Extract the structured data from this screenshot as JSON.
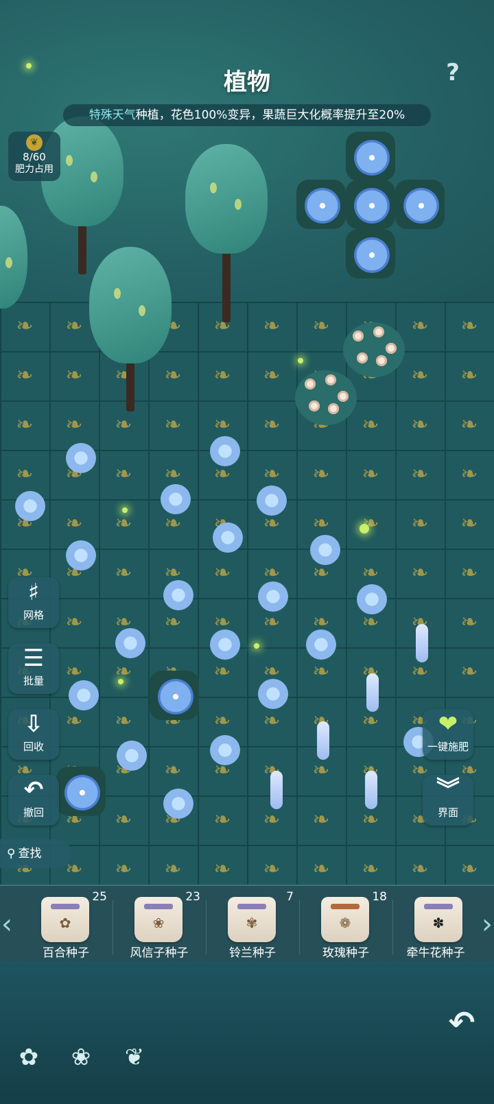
{
  "header": {
    "title": "植物",
    "help_icon": "?",
    "weather_banner": {
      "highlight": "特殊天气",
      "text": "种植，花色100%变异，果蔬巨大化概率提升至20%"
    }
  },
  "fertilizer": {
    "count": "8/60",
    "label": "肥力占用"
  },
  "side_tools": {
    "grid": "网格",
    "batch": "批量",
    "recycle": "回收",
    "undo": "撤回",
    "search": "查找"
  },
  "right_tools": {
    "fertilize_all": "一键施肥",
    "interface": "界面"
  },
  "seeds": [
    {
      "name": "百合种子",
      "count": "25"
    },
    {
      "name": "风信子种子",
      "count": "23"
    },
    {
      "name": "铃兰种子",
      "count": "7"
    },
    {
      "name": "玫瑰种子",
      "count": "18"
    },
    {
      "name": "牵牛花种子",
      "count": ""
    }
  ],
  "icons": {
    "arrow_left": "‹",
    "arrow_right": "›",
    "return": "↶",
    "nav_flower": "✿",
    "nav_bloom": "❀",
    "nav_corn": "❦"
  }
}
